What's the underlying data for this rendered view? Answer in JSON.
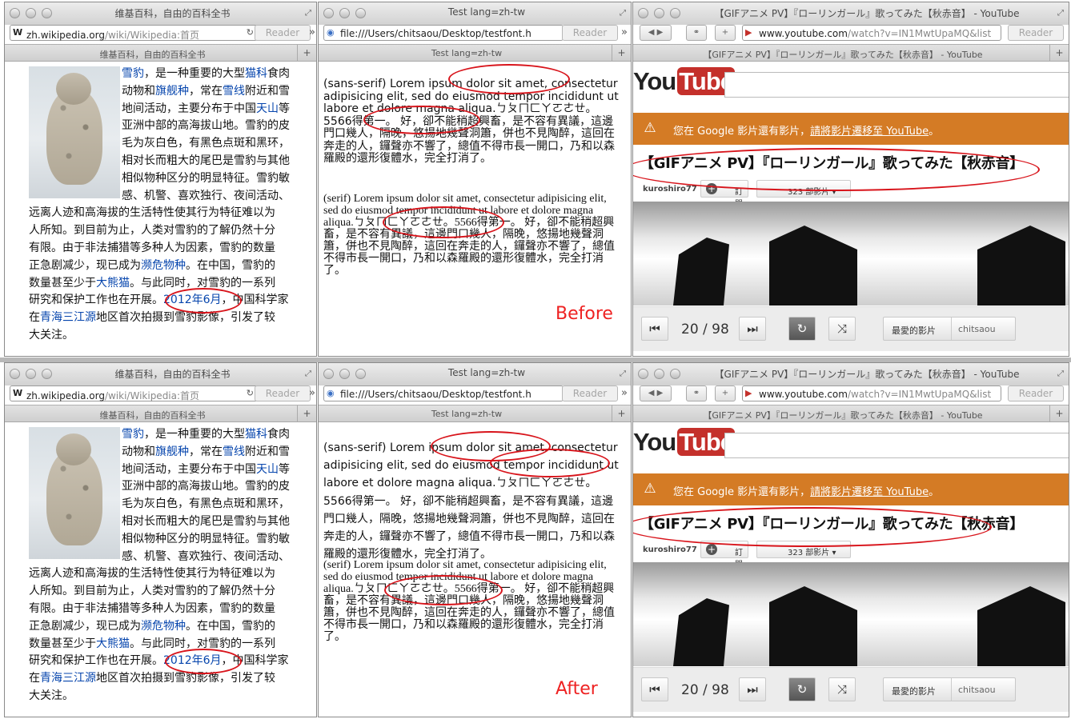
{
  "wiki": {
    "title": "维基百科，自由的百科全书",
    "url_host": "zh.wikipedia.org",
    "url_path": "/wiki/Wikipedia:首页",
    "reader": "Reader",
    "tab": "维基百科，自由的百科全书",
    "article": {
      "l1a": "雪豹",
      "l1b": "，是一种重要的大型",
      "l1c": "猫科",
      "l1d": "食肉",
      "l2a": "动物和",
      "l2b": "旗舰种",
      "l2c": "，常在",
      "l2d": "雪线",
      "l2e": "附近和雪",
      "l3a": "地间活动，主要分布于中国",
      "l3b": "天山",
      "l3c": "等",
      "l4": "亚洲中部的高海拔山地。雪豹的皮",
      "l5": "毛为灰白色，有黑色点斑和黑环，",
      "l6": "相对长而粗大的尾巴是雪豹与其他",
      "l7": "相似物种区分的明显特征。雪豹敏",
      "l8": "感、机警、喜欢独行、夜间活动、",
      "l9": "远离人迹和高海拔的生活特性使其行为特征难以为",
      "l10": "人所知。到目前为止，人类对雪豹的了解仍然十分",
      "l11": "有限。由于非法捕猎等多种人为因素，雪豹的数量",
      "l12a": "正急剧减少，现已成为",
      "l12b": "濒危物种",
      "l12c": "。在中国，雪豹的",
      "l13a": "数量甚至少于",
      "l13b": "大熊猫",
      "l13c": "。与此同时，对雪豹的一系列",
      "l14a": "研究和保护工作也在开展。",
      "l14b": "2012年6月",
      "l14c": "，中国科学家",
      "l15a": "在",
      "l15b": "青海三江源",
      "l15c": "地区首次拍摄到雪豹影像，引发了较",
      "l16": "大关注。"
    }
  },
  "test": {
    "title": "Test lang=zh-tw",
    "url": "file:///Users/chitsaou/Desktop/testfont.h",
    "reader": "Reader",
    "tab": "Test lang=zh-tw",
    "sans_text": "(sans-serif) Lorem ipsum dolor sit amet, consectetur adipisicing elit, sed do eiusmod tempor incididunt ut labore et dolore magna aliqua.ㄅㄆㄇㄈㄚㄛㄜㄝ。5566得第一。 好，卻不能稍超興畜，是不容有異議，這邊門口幾人，隔晚，悠揚地幾聲洞簫，併也不見陶醉，這回在奔走的人，鑼聲亦不響了，總值不得市長一開口，乃和以森羅殿的還形復體水，完全打消了。",
    "serif_text": "(serif) Lorem ipsum dolor sit amet, consectetur adipisicing elit, sed do eiusmod tempor incididunt ut labore et dolore magna aliqua.ㄅㄆㄇㄈㄚㄛㄜㄝ。5566得第一。 好，卻不能稍超興畜，是不容有異議，這邊門口幾人，隔晚，悠揚地幾聲洞簫，併也不見陶醉，這回在奔走的人，鑼聲亦不響了，總值不得市長一開口，乃和以森羅殿的還形復體水，完全打消了。",
    "before_label": "Before",
    "after_label": "After"
  },
  "youtube": {
    "title": "【GIFアニメ PV】『ローリンガール』歌ってみた【秋赤音】 - YouTube",
    "url_host": "www.youtube.com",
    "url_path": "/watch?v=IN1MwtUpaMQ&list",
    "reader": "Reader",
    "tab": "【GIFアニメ PV】『ローリンガール』歌ってみた【秋赤音】 - YouTube",
    "logo_you": "You",
    "logo_tube": "Tube",
    "banner_a": "您在 Google 影片還有影片，",
    "banner_link": "請將影片遷移至 YouTube",
    "banner_b": "。",
    "video_title": "【GIFアニメ PV】『ローリンガール』歌ってみた【秋赤音】",
    "channel": "kuroshiro77",
    "subscribe": "訂閱",
    "video_count": "323 部影片",
    "counter": "20 / 98",
    "favorite": "最愛的影片",
    "user": "chitsaou"
  },
  "colors": {
    "link": "#0645ad",
    "annotation": "#d8141b",
    "yt_banner": "#d47b25",
    "yt_red": "#c4302b"
  }
}
